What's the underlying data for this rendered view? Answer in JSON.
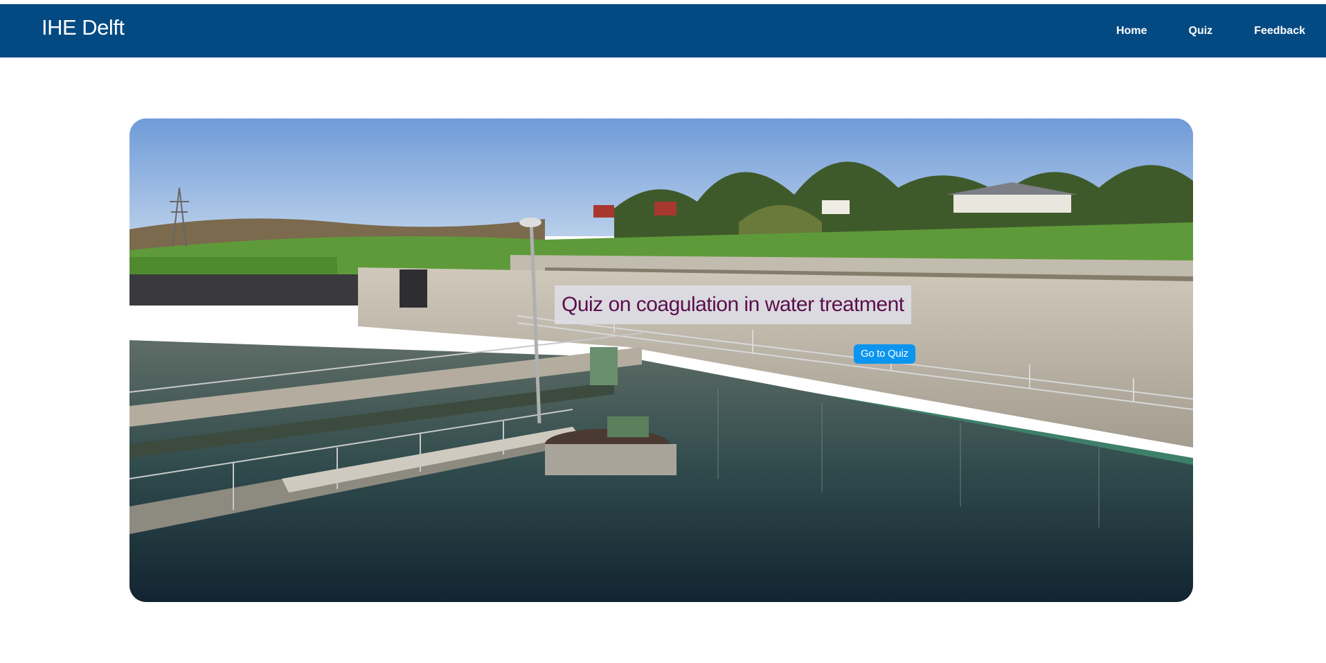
{
  "header": {
    "brand": "IHE Delft",
    "nav": {
      "home": "Home",
      "quiz": "Quiz",
      "feedback": "Feedback"
    }
  },
  "hero": {
    "title": "Quiz on coagulation in water treatment",
    "button_label": "Go to Quiz",
    "image_label": "water treatment plant photo"
  },
  "colors": {
    "navbar": "#044a82",
    "title_text": "#5a0e4d",
    "button": "#0b95ef"
  }
}
